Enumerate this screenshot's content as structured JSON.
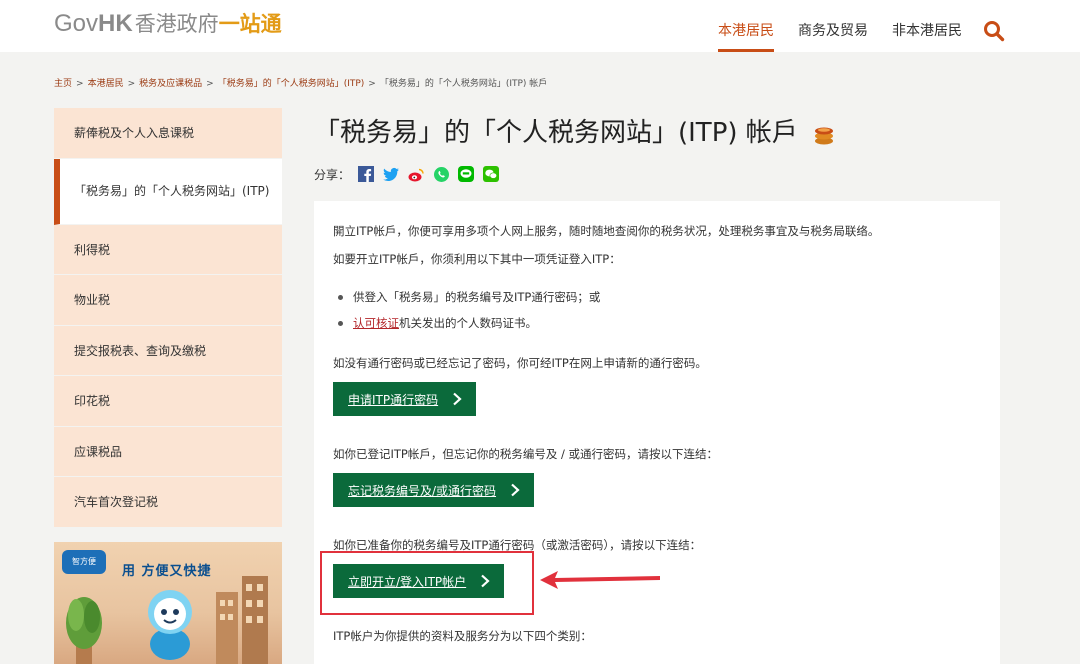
{
  "header": {
    "logo": {
      "gov": "Gov",
      "hk": "HK",
      "cn1": "香港政府",
      "cn2": "一站通"
    },
    "nav": [
      {
        "label": "本港居民"
      },
      {
        "label": "商务及贸易"
      },
      {
        "label": "非本港居民"
      }
    ],
    "search_icon": "search-icon",
    "accent": "#c84d16"
  },
  "breadcrumb": [
    "主页",
    "本港居民",
    "税务及应课税品",
    "「税务易」的「个人税务网站」(ITP)",
    "「税务易」的「个人税务网站」(ITP) 帐戶"
  ],
  "sidebar": {
    "items": [
      {
        "label": "薪俸税及个人入息课税"
      },
      {
        "label": "「税务易」的「个人税务网站」(ITP)"
      },
      {
        "label": "利得税"
      },
      {
        "label": "物业税"
      },
      {
        "label": "提交报税表、查询及缴税"
      },
      {
        "label": "印花税"
      },
      {
        "label": "应课税品"
      },
      {
        "label": "汽车首次登记税"
      }
    ],
    "banner": {
      "text": "用 方便又快捷",
      "logo": "智方便"
    }
  },
  "main": {
    "title": "「税务易」的「个人税务网站」(ITP) 帐戶",
    "share_label": "分享：",
    "share_icons": [
      "facebook-icon",
      "twitter-icon",
      "weibo-icon",
      "whatsapp-icon",
      "line-icon",
      "wechat-icon"
    ],
    "para1": "開立ITP帐戶，你便可享用多项个人网上服务，随时随地查阅你的税务状况，处理税务事宜及与税务局联络。",
    "para2": "如要开立ITP帐戶，你须利用以下其中一项凭证登入ITP：",
    "bullet1": "供登入「税务易」的税务编号及ITP通行密码；或",
    "bullet2_link": "认可核证",
    "bullet2_rest": "机关发出的个人数码证书。",
    "para3": "如没有通行密码或已经忘记了密码，你可经ITP在网上申请新的通行密码。",
    "btn1": "申请ITP通行密码",
    "para4": "如你已登记ITP帐戶，但忘记你的税务编号及 / 或通行密码，请按以下连结：",
    "btn2": "忘记税务编号及/或通行密码",
    "para5": "如你已准备你的税务编号及ITP通行密码（或激活密码），请按以下连结：",
    "btn3": "立即开立/登入ITP帐户",
    "para6": "ITP帐户为你提供的资料及服务分为以下四个类别：",
    "button_color": "#0b6a3b",
    "annotation_color": "#e1313c"
  }
}
